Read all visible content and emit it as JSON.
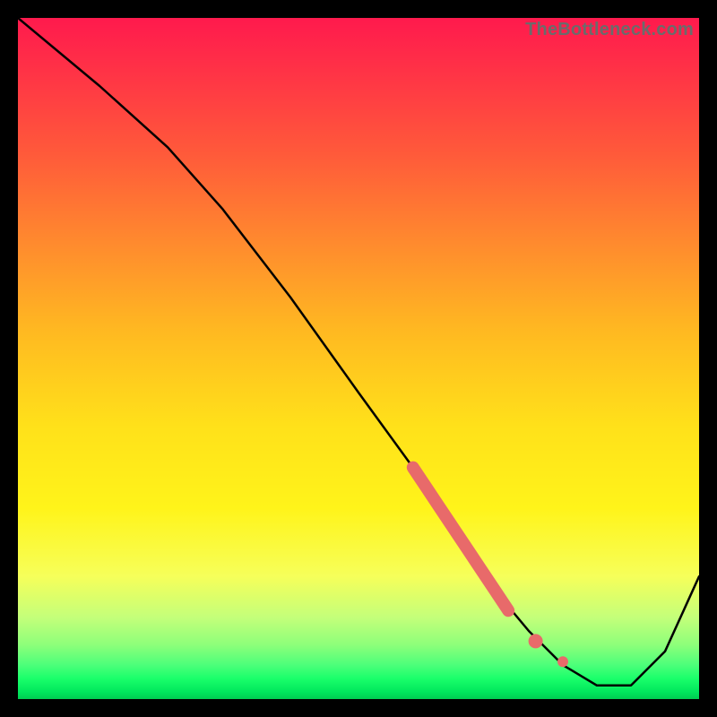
{
  "watermark": "TheBottleneck.com",
  "colors": {
    "curve_stroke": "#000000",
    "marker_fill": "#e86a6a",
    "marker_stroke": "#e86a6a"
  },
  "chart_data": {
    "type": "line",
    "title": "",
    "xlabel": "",
    "ylabel": "",
    "xlim": [
      0,
      100
    ],
    "ylim": [
      0,
      100
    ],
    "grid": false,
    "legend": false,
    "series": [
      {
        "name": "bottleneck-curve",
        "x": [
          0,
          12,
          22,
          30,
          40,
          50,
          58,
          64,
          70,
          75,
          80,
          85,
          90,
          95,
          100
        ],
        "values": [
          100,
          90,
          81,
          72,
          59,
          45,
          34,
          25,
          16,
          10,
          5,
          2,
          2,
          7,
          18
        ]
      }
    ],
    "markers": {
      "name": "highlight-segment",
      "x": [
        58,
        60,
        62,
        64,
        66,
        68,
        70,
        72,
        76,
        80
      ],
      "values": [
        34,
        31,
        28,
        25,
        22,
        19,
        16,
        13,
        8.5,
        5.5
      ]
    }
  }
}
